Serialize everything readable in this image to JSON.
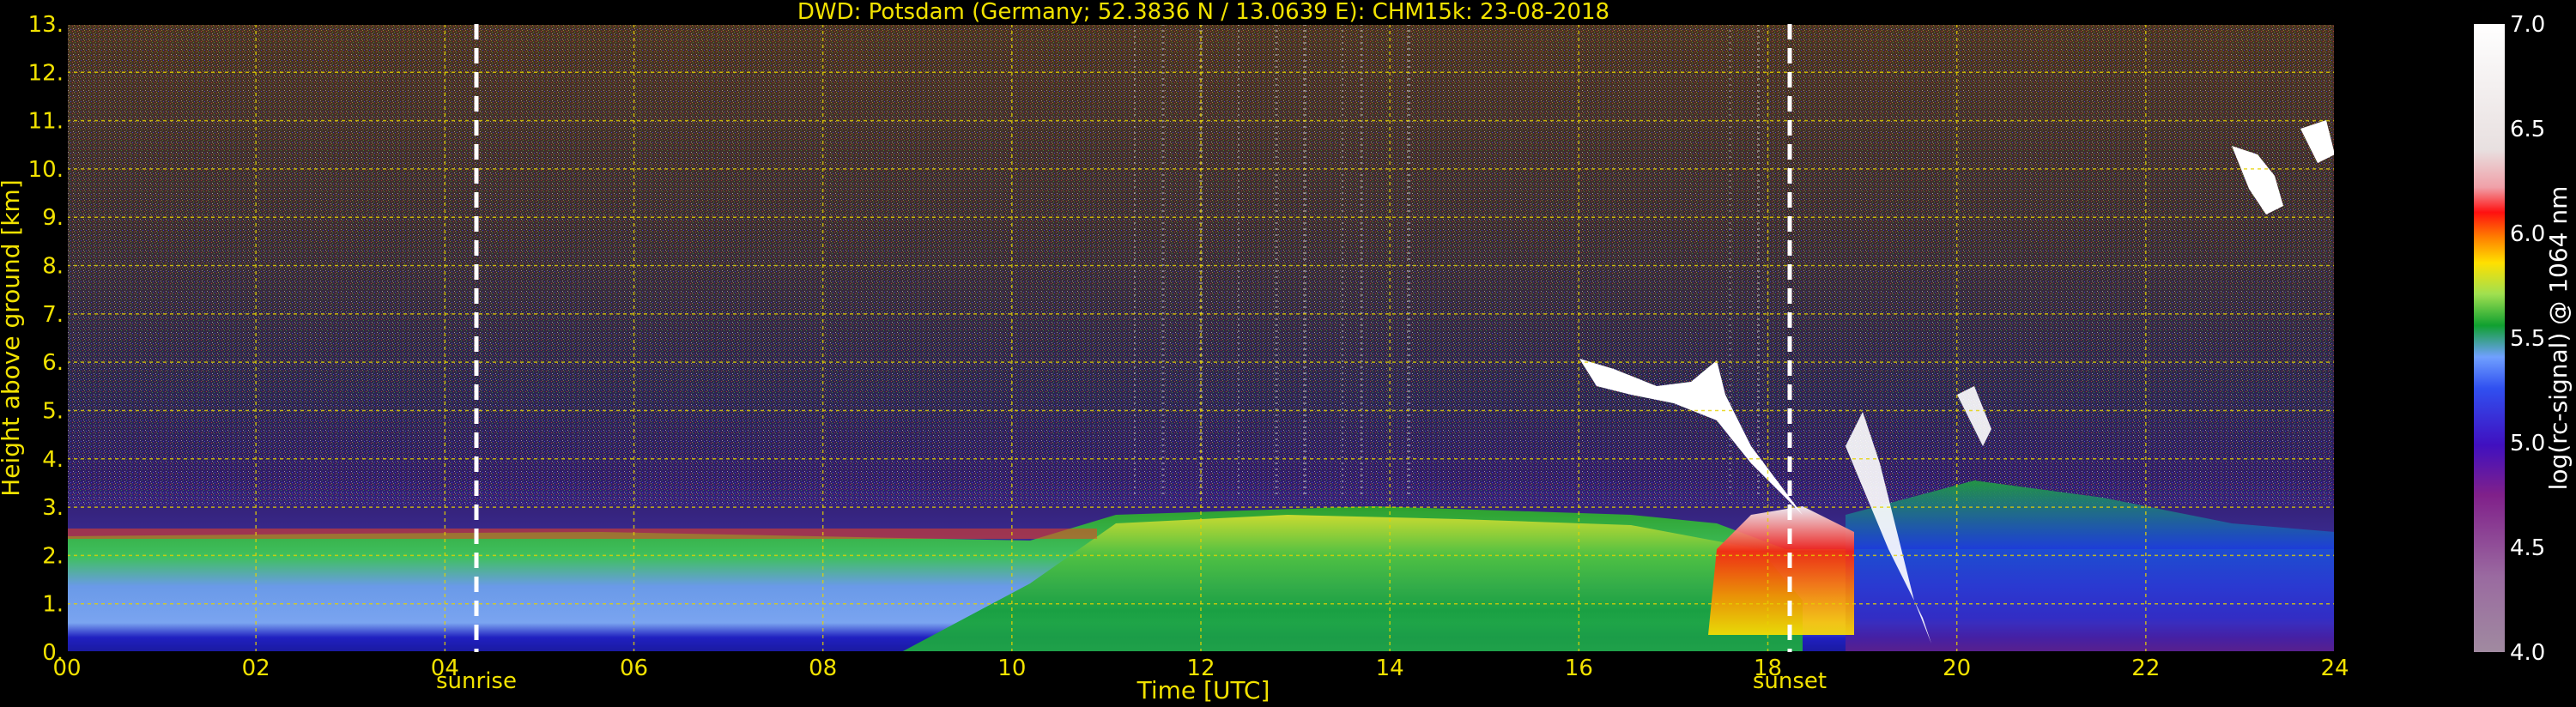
{
  "chart_data": {
    "type": "heatmap",
    "title": "DWD: Potsdam (Germany; 52.3836 N / 13.0639 E):    CHM15k: 23-08-2018",
    "xlabel": "Time [UTC]",
    "ylabel": "Height above ground [km]",
    "xlim": [
      0,
      24
    ],
    "ylim": [
      0,
      13
    ],
    "x_ticks": [
      "00",
      "02",
      "04",
      "06",
      "08",
      "10",
      "12",
      "14",
      "16",
      "18",
      "20",
      "22",
      "24"
    ],
    "y_ticks": [
      "0.",
      "1.",
      "2.",
      "3.",
      "4.",
      "5.",
      "6.",
      "7.",
      "8.",
      "9.",
      "10.",
      "11.",
      "12.",
      "13."
    ],
    "grid": true,
    "annotations": [
      {
        "label": "sunrise",
        "x": 4.3
      },
      {
        "label": "sunset",
        "x": 18.2
      }
    ],
    "colorbar": {
      "label": "log(rc-signal) @ 1064 nm",
      "range": [
        4.0,
        7.0
      ],
      "ticks": [
        "4.0",
        "4.5",
        "5.0",
        "5.5",
        "6.0",
        "6.5",
        "7.0"
      ]
    },
    "layers": [
      {
        "name": "boundary-layer-top",
        "height_km": [
          2.35,
          2.4,
          2.5,
          2.55,
          2.45,
          2.5,
          2.7,
          2.8,
          2.75,
          2.9,
          3.0,
          2.5,
          2.3
        ]
      },
      {
        "name": "cloud-1",
        "x": [
          16.0,
          17.6
        ],
        "height_km": [
          5.2,
          6.1
        ]
      },
      {
        "name": "cloud-2",
        "x": [
          23.0,
          24.0
        ],
        "height_km": [
          9.0,
          11.0
        ]
      }
    ]
  },
  "colors": {
    "text": "#f2e200",
    "grid": "#e6d200",
    "background": "#000000"
  }
}
